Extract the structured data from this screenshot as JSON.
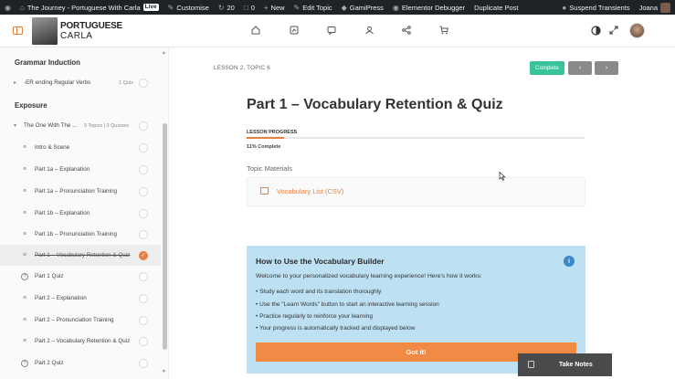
{
  "admin_bar": {
    "site_title": "The Journey - Portuguese With Carla",
    "live_badge": "Live",
    "customise": "Customise",
    "updates_count": "20",
    "comments_count": "0",
    "new_label": "New",
    "edit_topic": "Edit Topic",
    "gamipress": "GamiPress",
    "elementor_debugger": "Elementor Debugger",
    "duplicate_post": "Duplicate Post",
    "suspend_transients": "Suspend Transients",
    "user_name": "Joana"
  },
  "logo": {
    "line1": "PORTUGUESE",
    "line2": "CARLA"
  },
  "sidebar": {
    "section1_title": "Grammar Induction",
    "section1_item": {
      "label": "-ER ending Regular Verbs",
      "meta": "1 Quiz"
    },
    "section2_title": "Exposure",
    "section2_group": {
      "label": "The One With The ...",
      "meta": "9 Topics  |  3 Quizzes"
    },
    "items": [
      {
        "label": "Intro & Scene",
        "icon": "list-icon"
      },
      {
        "label": "Part 1a – Explanation",
        "icon": "list-icon"
      },
      {
        "label": "Part 1a – Pronunciation Training",
        "icon": "list-icon"
      },
      {
        "label": "Part 1b – Explanation",
        "icon": "list-icon"
      },
      {
        "label": "Part 1b – Pronunciation Training",
        "icon": "list-icon"
      },
      {
        "label": "Part 1 – Vocabulary Retention & Quiz",
        "icon": "list-icon"
      },
      {
        "label": "Part 1 Quiz",
        "icon": "quiz-icon"
      },
      {
        "label": "Part 2 – Explanation",
        "icon": "list-icon"
      },
      {
        "label": "Part 2 – Pronunciation Training",
        "icon": "list-icon"
      },
      {
        "label": "Part 2 – Vocabulary Retention & Quiz",
        "icon": "list-icon"
      },
      {
        "label": "Part 2 Quiz",
        "icon": "quiz-icon"
      }
    ]
  },
  "content": {
    "breadcrumb": "LESSON 2, TOPIC 6",
    "complete_button": "Complete",
    "prev_button": "‹",
    "next_button": "›",
    "title": "Part 1 – Vocabulary Retention & Quiz",
    "progress_label": "LESSON PROGRESS",
    "progress_fraction": 0.11,
    "progress_text": "11% Complete",
    "materials_label": "Topic Materials",
    "materials_link": "Vocabulary List (CSV)"
  },
  "vocab_builder": {
    "title": "How to Use the Vocabulary Builder",
    "info": "i",
    "intro": "Welcome to your personalized vocabulary learning experience! Here's how it works:",
    "bullets": [
      "•  Study each word and its translation thoroughly",
      "•  Use the \"Learn Words\" button to start an interactive learning session",
      "•  Practice regularly to reinforce your learning",
      "•  Your progress is automatically tracked and displayed below"
    ],
    "button": "Got it!"
  },
  "notes": {
    "label": "Take Notes"
  },
  "colors": {
    "accent": "#e57f44",
    "complete": "#3ac29a",
    "info_bg": "#bde0f2",
    "admin_bar": "#1d2327"
  }
}
